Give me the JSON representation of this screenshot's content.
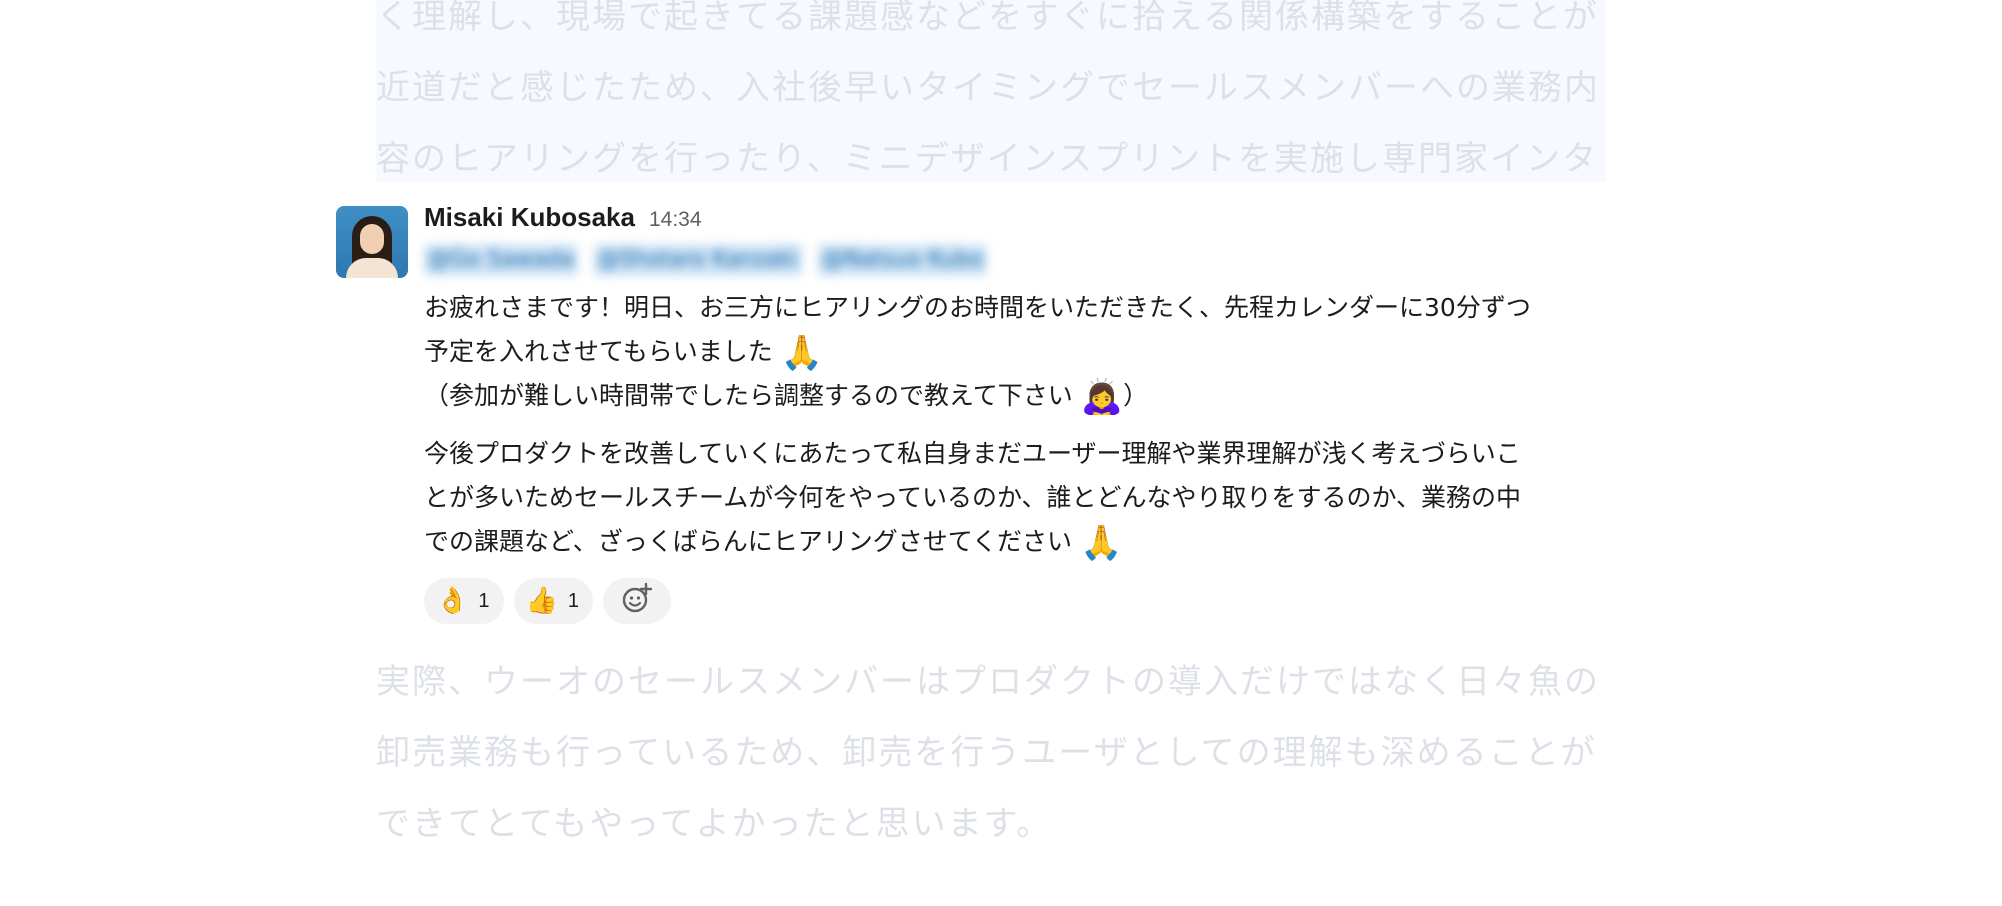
{
  "background_article": {
    "top_lines": [
      "く理解し、現場で起きてる課題感などをすぐに拾える関係構築をすることが",
      "近道だと感じたため、入社後早いタイミングでセールスメンバーへの業務内",
      "容のヒアリングを行ったり、ミニデザインスプリントを実施し専門家インタ"
    ],
    "bottom_lines": [
      "実際、ウーオのセールスメンバーはプロダクトの導入だけではなく日々魚の",
      "卸売業務も行っているため、卸売を行うユーザとしての理解も深めることが",
      "できてとてもやってよかったと思います。"
    ]
  },
  "message": {
    "author": "Misaki Kubosaka",
    "time": "14:34",
    "mentions": [
      "@Go Sawada",
      "@Shotaro Kanzaki",
      "@Natsuo Kubo"
    ],
    "para1": {
      "line1": "お疲れさまです！明日、お三方にヒアリングのお時間をいただきたく、先程カレンダーに30分ずつ",
      "line2": "予定を入れさせてもらいました",
      "line2_emoji": "🙏",
      "line3_open": "（参加が難しい時間帯でしたら調整するので教えて下さい",
      "line3_emoji": "🙇‍♀️",
      "line3_close": "）"
    },
    "para2": {
      "line1": "今後プロダクトを改善していくにあたって私自身まだユーザー理解や業界理解が浅く考えづらいこ",
      "line2": "とが多いためセールスチームが今何をやっているのか、誰とどんなやり取りをするのか、業務の中",
      "line3": "での課題など、ざっくばらんにヒアリングさせてください",
      "line3_emoji": "🙏"
    },
    "reactions": [
      {
        "emoji": "👌",
        "count": "1"
      },
      {
        "emoji": "👍",
        "count": "1"
      }
    ],
    "add_reaction_icon": "add-reaction-icon"
  }
}
